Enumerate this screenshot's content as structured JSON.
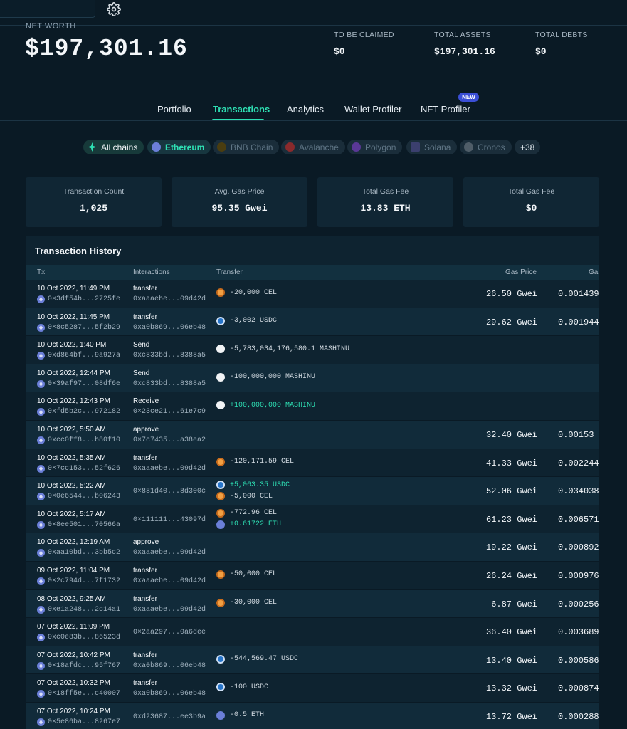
{
  "net_worth": {
    "label": "NET WORTH",
    "value": "$197,301.16"
  },
  "stats": [
    {
      "label": "TO BE CLAIMED",
      "value": "$0"
    },
    {
      "label": "TOTAL ASSETS",
      "value": "$197,301.16"
    },
    {
      "label": "TOTAL DEBTS",
      "value": "$0"
    }
  ],
  "tabs": [
    {
      "label": "Portfolio"
    },
    {
      "label": "Transactions"
    },
    {
      "label": "Analytics"
    },
    {
      "label": "Wallet Profiler"
    },
    {
      "label": "NFT Profiler"
    }
  ],
  "new_badge": "NEW",
  "chains": [
    {
      "label": "All chains",
      "color": "#2ee0b4"
    },
    {
      "label": "Ethereum",
      "color": "#6b7fd8"
    },
    {
      "label": "BNB Chain",
      "color": "#f0b90b"
    },
    {
      "label": "Avalanche",
      "color": "#e84142"
    },
    {
      "label": "Polygon",
      "color": "#8247e5"
    },
    {
      "label": "Solana",
      "color": "#9945ff"
    },
    {
      "label": "Cronos",
      "color": "#8a98a6"
    },
    {
      "label": "+38"
    }
  ],
  "summary": [
    {
      "label": "Transaction Count",
      "value": "1,025"
    },
    {
      "label": "Avg. Gas Price",
      "value": "95.35 Gwei"
    },
    {
      "label": "Total Gas Fee",
      "value": "13.83 ETH"
    },
    {
      "label": "Total Gas Fee",
      "value": "$0"
    }
  ],
  "history": {
    "title": "Transaction History",
    "columns": {
      "tx": "Tx",
      "interactions": "Interactions",
      "transfer": "Transfer",
      "gas_price": "Gas Price",
      "gas_fee": "Ga"
    },
    "rows": [
      {
        "date": "10 Oct 2022, 11:49 PM",
        "hash": "0×3df54b...2725fe",
        "method": "transfer",
        "address": "0xaaaebe...09d42d",
        "transfers": [
          {
            "token": "cel",
            "amount": "-20,000 CEL",
            "dir": "neg"
          }
        ],
        "gas": "26.50 Gwei",
        "fee": "0.001439"
      },
      {
        "date": "10 Oct 2022, 11:45 PM",
        "hash": "0×8c5287...5f2b29",
        "method": "transfer",
        "address": "0xa0b869...06eb48",
        "transfers": [
          {
            "token": "usdc",
            "amount": "-3,002 USDC",
            "dir": "neg"
          }
        ],
        "gas": "29.62 Gwei",
        "fee": "0.001944"
      },
      {
        "date": "10 Oct 2022, 1:40 PM",
        "hash": "0xd864bf...9a927a",
        "method": "Send",
        "address": "0xc833bd...8388a5",
        "transfers": [
          {
            "token": "mashinu",
            "amount": "-5,783,034,176,580.1 MASHINU",
            "dir": "neg"
          }
        ],
        "gas": "",
        "fee": ""
      },
      {
        "date": "10 Oct 2022, 12:44 PM",
        "hash": "0×39af97...08df6e",
        "method": "Send",
        "address": "0xc833bd...8388a5",
        "transfers": [
          {
            "token": "mashinu",
            "amount": "-100,000,000 MASHINU",
            "dir": "neg"
          }
        ],
        "gas": "",
        "fee": ""
      },
      {
        "date": "10 Oct 2022, 12:43 PM",
        "hash": "0xfd5b2c...972182",
        "method": "Receive",
        "address": "0×23ce21...61e7c9",
        "transfers": [
          {
            "token": "mashinu",
            "amount": "+100,000,000 MASHINU",
            "dir": "pos"
          }
        ],
        "gas": "",
        "fee": ""
      },
      {
        "date": "10 Oct 2022, 5:50 AM",
        "hash": "0xcc0ff8...b80f10",
        "method": "approve",
        "address": "0×7c7435...a38ea2",
        "transfers": [],
        "gas": "32.40 Gwei",
        "fee": "0.00153"
      },
      {
        "date": "10 Oct 2022, 5:35 AM",
        "hash": "0×7cc153...52f626",
        "method": "transfer",
        "address": "0xaaaebe...09d42d",
        "transfers": [
          {
            "token": "cel",
            "amount": "-120,171.59 CEL",
            "dir": "neg"
          }
        ],
        "gas": "41.33 Gwei",
        "fee": "0.002244"
      },
      {
        "date": "10 Oct 2022, 5:22 AM",
        "hash": "0×0e6544...b06243",
        "method": "",
        "address": "0×881d40...8d300c",
        "transfers": [
          {
            "token": "usdc",
            "amount": "+5,063.35 USDC",
            "dir": "pos"
          },
          {
            "token": "cel",
            "amount": "-5,000 CEL",
            "dir": "neg"
          }
        ],
        "gas": "52.06 Gwei",
        "fee": "0.034038"
      },
      {
        "date": "10 Oct 2022, 5:17 AM",
        "hash": "0×8ee501...70566a",
        "method": "",
        "address": "0×111111...43097d",
        "transfers": [
          {
            "token": "cel",
            "amount": "-772.96 CEL",
            "dir": "neg"
          },
          {
            "token": "eth",
            "amount": "+0.61722 ETH",
            "dir": "pos"
          }
        ],
        "gas": "61.23 Gwei",
        "fee": "0.006571"
      },
      {
        "date": "10 Oct 2022, 12:19 AM",
        "hash": "0xaa10bd...3bb5c2",
        "method": "approve",
        "address": "0xaaaebe...09d42d",
        "transfers": [],
        "gas": "19.22 Gwei",
        "fee": "0.000892"
      },
      {
        "date": "09 Oct 2022, 11:04 PM",
        "hash": "0×2c794d...7f1732",
        "method": "transfer",
        "address": "0xaaaebe...09d42d",
        "transfers": [
          {
            "token": "cel",
            "amount": "-50,000 CEL",
            "dir": "neg"
          }
        ],
        "gas": "26.24 Gwei",
        "fee": "0.000976"
      },
      {
        "date": "08 Oct 2022, 9:25 AM",
        "hash": "0xe1a248...2c14a1",
        "method": "transfer",
        "address": "0xaaaebe...09d42d",
        "transfers": [
          {
            "token": "cel",
            "amount": "-30,000 CEL",
            "dir": "neg"
          }
        ],
        "gas": "6.87 Gwei",
        "fee": "0.000256"
      },
      {
        "date": "07 Oct 2022, 11:09 PM",
        "hash": "0xc0e83b...86523d",
        "method": "",
        "address": "0×2aa297...0a6dee",
        "transfers": [],
        "gas": "36.40 Gwei",
        "fee": "0.003689"
      },
      {
        "date": "07 Oct 2022, 10:42 PM",
        "hash": "0×18afdc...95f767",
        "method": "transfer",
        "address": "0xa0b869...06eb48",
        "transfers": [
          {
            "token": "usdc",
            "amount": "-544,569.47 USDC",
            "dir": "neg"
          }
        ],
        "gas": "13.40 Gwei",
        "fee": "0.000586"
      },
      {
        "date": "07 Oct 2022, 10:32 PM",
        "hash": "0×18ff5e...c40007",
        "method": "transfer",
        "address": "0xa0b869...06eb48",
        "transfers": [
          {
            "token": "usdc",
            "amount": "-100 USDC",
            "dir": "neg"
          }
        ],
        "gas": "13.32 Gwei",
        "fee": "0.000874"
      },
      {
        "date": "07 Oct 2022, 10:24 PM",
        "hash": "0×5e86ba...8267e7",
        "method": "",
        "address": "0xd23687...ee3b9a",
        "transfers": [
          {
            "token": "eth",
            "amount": "-0.5 ETH",
            "dir": "neg"
          }
        ],
        "gas": "13.72 Gwei",
        "fee": "0.000288"
      }
    ]
  },
  "icons": {
    "settings": "gear-icon",
    "eth": "ethereum-icon"
  }
}
